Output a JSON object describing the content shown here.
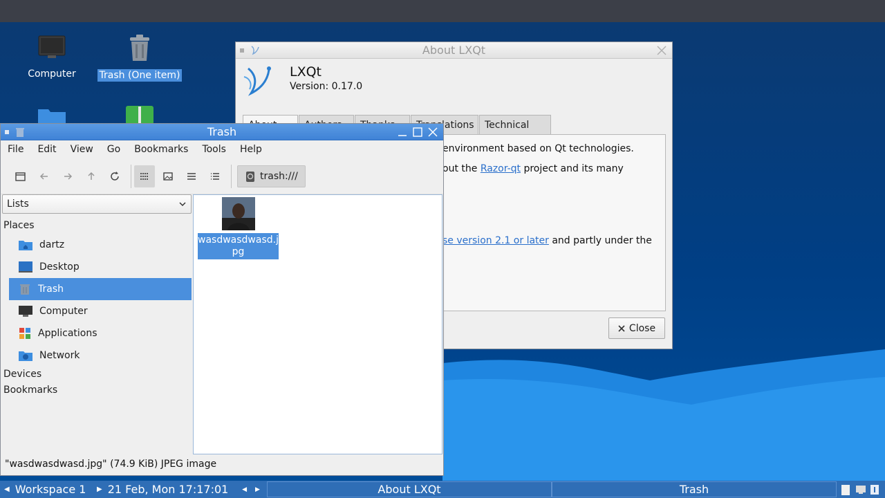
{
  "desktop": {
    "icons": [
      {
        "label": "Computer",
        "icon": "monitor-icon"
      },
      {
        "label": "Trash (One item)",
        "icon": "trash-icon"
      },
      {
        "label": "",
        "icon": "folder-icon"
      },
      {
        "label": "",
        "icon": "archive-icon"
      }
    ]
  },
  "about": {
    "window_title": "About LXQt",
    "app_name": "LXQt",
    "version": "Version: 0.17.0",
    "tabs": [
      "About",
      "Authors",
      "Thanks",
      "Translations",
      "Technical Info"
    ],
    "line1": "environment based on Qt technologies.",
    "line2_pre": "out the ",
    "line2_link": "Razor-qt",
    "line2_post": " project and its many",
    "line3_link": "se version 2.1 or later",
    "line3_post": " and partly under the",
    "close_label": "Close"
  },
  "fm": {
    "window_title": "Trash",
    "menus": [
      "File",
      "Edit",
      "View",
      "Go",
      "Bookmarks",
      "Tools",
      "Help"
    ],
    "path": "trash:///",
    "side_mode": "Lists",
    "sections": {
      "places": "Places",
      "devices": "Devices",
      "bookmarks": "Bookmarks"
    },
    "places": [
      {
        "label": "dartz",
        "icon": "home-folder-icon"
      },
      {
        "label": "Desktop",
        "icon": "desktop-icon"
      },
      {
        "label": "Trash",
        "icon": "trash-icon"
      },
      {
        "label": "Computer",
        "icon": "computer-icon"
      },
      {
        "label": "Applications",
        "icon": "applications-icon"
      },
      {
        "label": "Network",
        "icon": "network-icon"
      }
    ],
    "file": {
      "name": "wasdwasdwasd.jpg"
    },
    "status": "\"wasdwasdwasd.jpg\" (74.9 KiB) JPEG image"
  },
  "taskbar": {
    "workspace": "Workspace 1",
    "clock": "21 Feb, Mon 17:17:01",
    "tasks": [
      "About LXQt",
      "Trash"
    ]
  },
  "colors": {
    "accent": "#4a8fdd",
    "taskbar": "#2f6eb6"
  }
}
